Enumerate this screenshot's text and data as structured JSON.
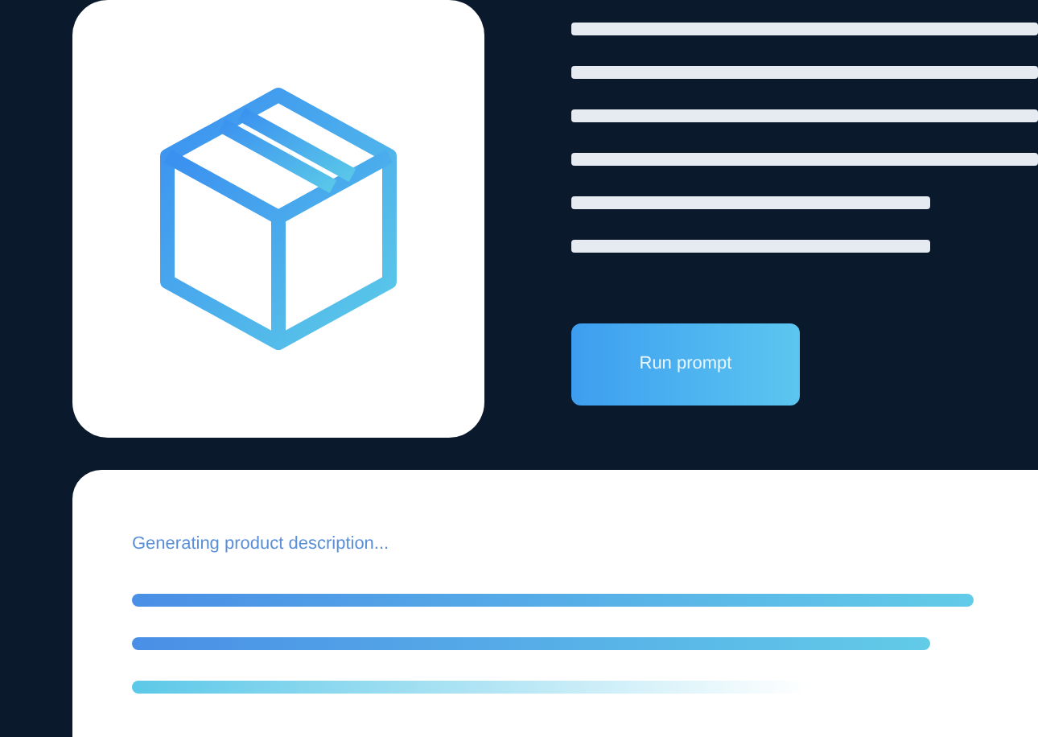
{
  "product_card": {
    "button": "Run prompt"
  },
  "output_panel": {
    "status": "Generating product description..."
  }
}
